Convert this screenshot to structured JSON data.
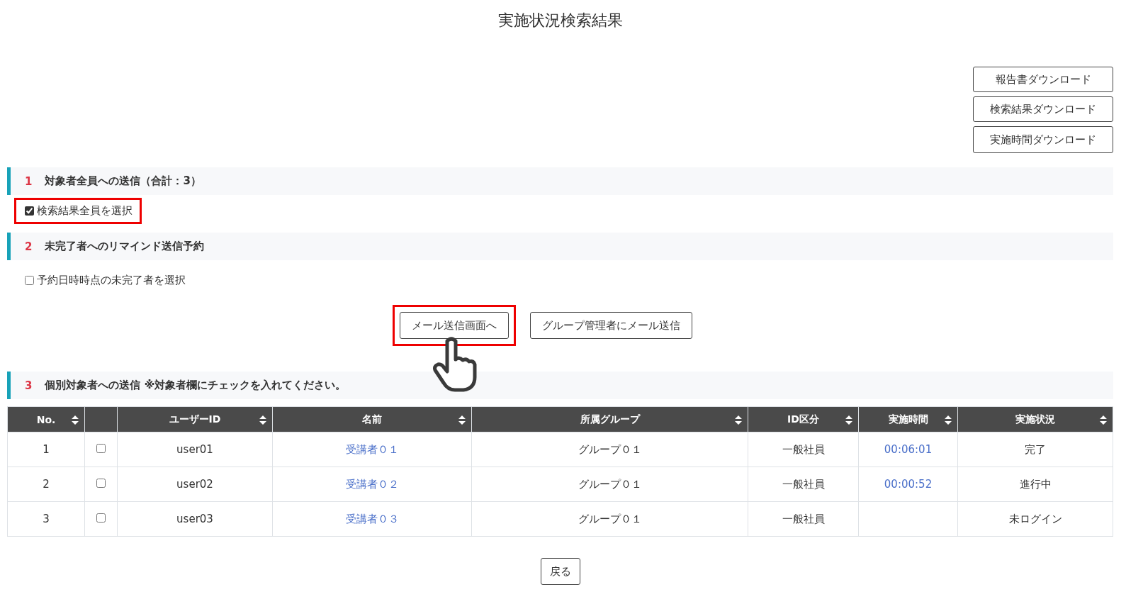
{
  "title": "実施状況検索結果",
  "downloads": [
    "報告書ダウンロード",
    "検索結果ダウンロード",
    "実施時間ダウンロード"
  ],
  "sections": [
    {
      "number": "1",
      "heading": "対象者全員への送信（合計：3）",
      "option": {
        "label": "検索結果全員を選択",
        "checked": true,
        "highlighted": true
      }
    },
    {
      "number": "2",
      "heading": "未完了者へのリマインド送信予約",
      "option": {
        "label": "予約日時時点の未完了者を選択",
        "checked": false,
        "highlighted": false
      }
    }
  ],
  "actions": [
    {
      "label": "メール送信画面へ",
      "highlighted": true,
      "pointer": true
    },
    {
      "label": "グループ管理者にメール送信",
      "highlighted": false,
      "pointer": false
    }
  ],
  "section3": {
    "number": "3",
    "heading": "個別対象者への送信 ※対象者欄にチェックを入れてください。"
  },
  "table": {
    "columns": [
      {
        "label": "No.",
        "sortable": true
      },
      {
        "sortable": false
      },
      {
        "label": "ユーザーID",
        "sortable": true
      },
      {
        "label": "名前",
        "sortable": true
      },
      {
        "label": "所属グループ",
        "sortable": true
      },
      {
        "label": "ID区分",
        "sortable": true
      },
      {
        "label": "実施時間",
        "sortable": true
      },
      {
        "label": "実施状況",
        "sortable": true
      }
    ],
    "rows": [
      {
        "no": "1",
        "checked": false,
        "user_id": "user01",
        "name": "受講者０１",
        "group": "グループ０１",
        "id_type": "一般社員",
        "time": "00:06:01",
        "status": "完了"
      },
      {
        "no": "2",
        "checked": false,
        "user_id": "user02",
        "name": "受講者０２",
        "group": "グループ０１",
        "id_type": "一般社員",
        "time": "00:00:52",
        "status": "進行中"
      },
      {
        "no": "3",
        "checked": false,
        "user_id": "user03",
        "name": "受講者０３",
        "group": "グループ０１",
        "id_type": "一般社員",
        "status": "未ログイン"
      }
    ]
  },
  "back_button": "戻る"
}
